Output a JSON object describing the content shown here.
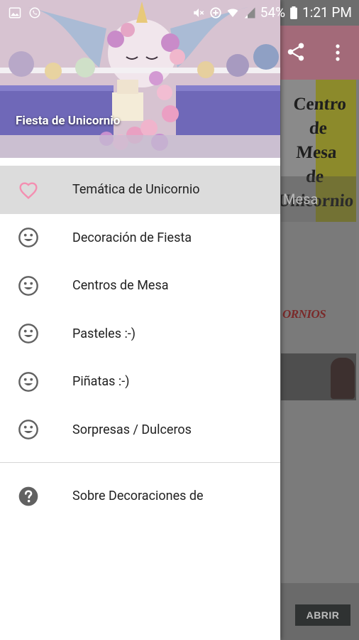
{
  "status_bar": {
    "battery": "54%",
    "time": "1:21 PM",
    "icons": [
      "gallery-icon",
      "whatsapp-icon",
      "mute-icon",
      "data-saver-icon",
      "wifi-icon",
      "signal-icon",
      "battery-icon"
    ]
  },
  "drawer": {
    "header_title": "Fiesta de Unicornio",
    "items": [
      {
        "label": "Temática de Unicornio",
        "icon": "heart-icon",
        "active": true
      },
      {
        "label": "Decoración de Fiesta",
        "icon": "smiley-icon"
      },
      {
        "label": "Centros de Mesa",
        "icon": "smiley-icon"
      },
      {
        "label": "Pasteles :-)",
        "icon": "smiley-icon"
      },
      {
        "label": "Piñatas :-)",
        "icon": "smiley-icon"
      },
      {
        "label": "Sorpresas / Dulceros",
        "icon": "smiley-icon"
      }
    ],
    "about": {
      "label": "Sobre Decoraciones de",
      "icon": "help-icon"
    }
  },
  "background_app": {
    "card1_text_lines": [
      "Centro de",
      "Mesa",
      "de",
      "Unicornio"
    ],
    "card1_caption": "Mesa",
    "card2_text": "ORNIOS",
    "abrir_button": "ABRIR"
  },
  "colors": {
    "toolbar": "#a36a79",
    "active_item_bg": "#dcdcdc",
    "heart_accent": "#f48fb1",
    "icon_gray": "#616161"
  }
}
